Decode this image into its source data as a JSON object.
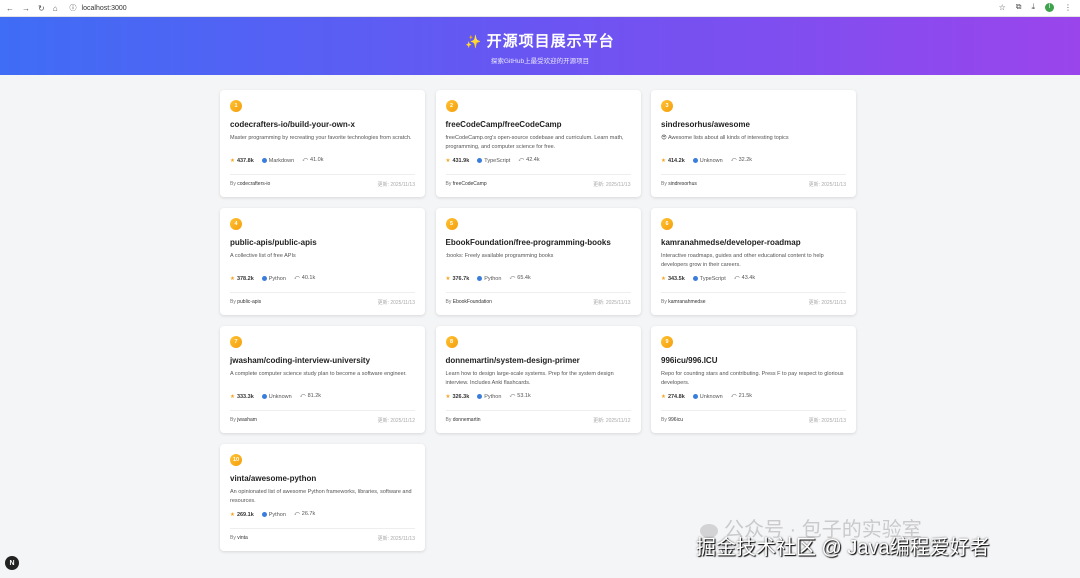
{
  "browser": {
    "url": "localhost:3000",
    "nav_icons": [
      "back-icon",
      "forward-icon",
      "reload-icon",
      "home-icon"
    ],
    "right_icons": [
      "bookmark-star-icon",
      "extensions-icon",
      "download-icon"
    ],
    "avatar": "I"
  },
  "header": {
    "logo_icon": "sparkle-icon",
    "title": "开源项目展示平台",
    "subtitle": "探索GitHub上最受欢迎的开源项目",
    "gradient": [
      "#3f6df5",
      "#9a45ec"
    ]
  },
  "projects": [
    {
      "rank": "1",
      "name": "codecrafters-io/build-your-own-x",
      "description": "Master programming by recreating your favorite technologies from scratch.",
      "stars": "437.8k",
      "language": "Markdown",
      "forks": "41.0k",
      "owner": "codecrafters-io",
      "updated": "更新: 2025/11/13"
    },
    {
      "rank": "2",
      "name": "freeCodeCamp/freeCodeCamp",
      "description": "freeCodeCamp.org's open-source codebase and curriculum. Learn math, programming, and computer science for free.",
      "stars": "431.9k",
      "language": "TypeScript",
      "forks": "42.4k",
      "owner": "freeCodeCamp",
      "updated": "更新: 2025/11/13"
    },
    {
      "rank": "3",
      "name": "sindresorhus/awesome",
      "description": "😎 Awesome lists about all kinds of interesting topics",
      "stars": "414.2k",
      "language": "Unknown",
      "forks": "32.2k",
      "owner": "sindresorhus",
      "updated": "更新: 2025/11/13"
    },
    {
      "rank": "4",
      "name": "public-apis/public-apis",
      "description": "A collective list of free APIs",
      "stars": "378.2k",
      "language": "Python",
      "forks": "40.1k",
      "owner": "public-apis",
      "updated": "更新: 2025/11/13"
    },
    {
      "rank": "5",
      "name": "EbookFoundation/free-programming-books",
      "description": ":books: Freely available programming books",
      "stars": "376.7k",
      "language": "Python",
      "forks": "65.4k",
      "owner": "EbookFoundation",
      "updated": "更新: 2025/11/13"
    },
    {
      "rank": "6",
      "name": "kamranahmedse/developer-roadmap",
      "description": "Interactive roadmaps, guides and other educational content to help developers grow in their careers.",
      "stars": "343.5k",
      "language": "TypeScript",
      "forks": "43.4k",
      "owner": "kamranahmedse",
      "updated": "更新: 2025/11/13"
    },
    {
      "rank": "7",
      "name": "jwasham/coding-interview-university",
      "description": "A complete computer science study plan to become a software engineer.",
      "stars": "333.3k",
      "language": "Unknown",
      "forks": "81.2k",
      "owner": "jwasham",
      "updated": "更新: 2025/11/12"
    },
    {
      "rank": "8",
      "name": "donnemartin/system-design-primer",
      "description": "Learn how to design large-scale systems. Prep for the system design interview. Includes Anki flashcards.",
      "stars": "326.3k",
      "language": "Python",
      "forks": "53.1k",
      "owner": "donnemartin",
      "updated": "更新: 2025/11/12"
    },
    {
      "rank": "9",
      "name": "996icu/996.ICU",
      "description": "Repo for counting stars and contributing. Press F to pay respect to glorious developers.",
      "stars": "274.8k",
      "language": "Unknown",
      "forks": "21.5k",
      "owner": "996icu",
      "updated": "更新: 2025/11/13"
    },
    {
      "rank": "10",
      "name": "vinta/awesome-python",
      "description": "An opinionated list of awesome Python frameworks, libraries, software and resources.",
      "stars": "269.1k",
      "language": "Python",
      "forks": "26.7k",
      "owner": "vinta",
      "updated": "更新: 2025/11/13"
    }
  ],
  "labels": {
    "by": "By"
  },
  "watermark": {
    "line1": "公众号 · 包子的实验室",
    "line2": "掘金技术社区 @ Java编程爱好者"
  },
  "corner_button": "N",
  "colors": {
    "rank_badge": "#f5a623",
    "language_dot": "#3b7ddd",
    "page_bg": "#f4f5f7"
  }
}
